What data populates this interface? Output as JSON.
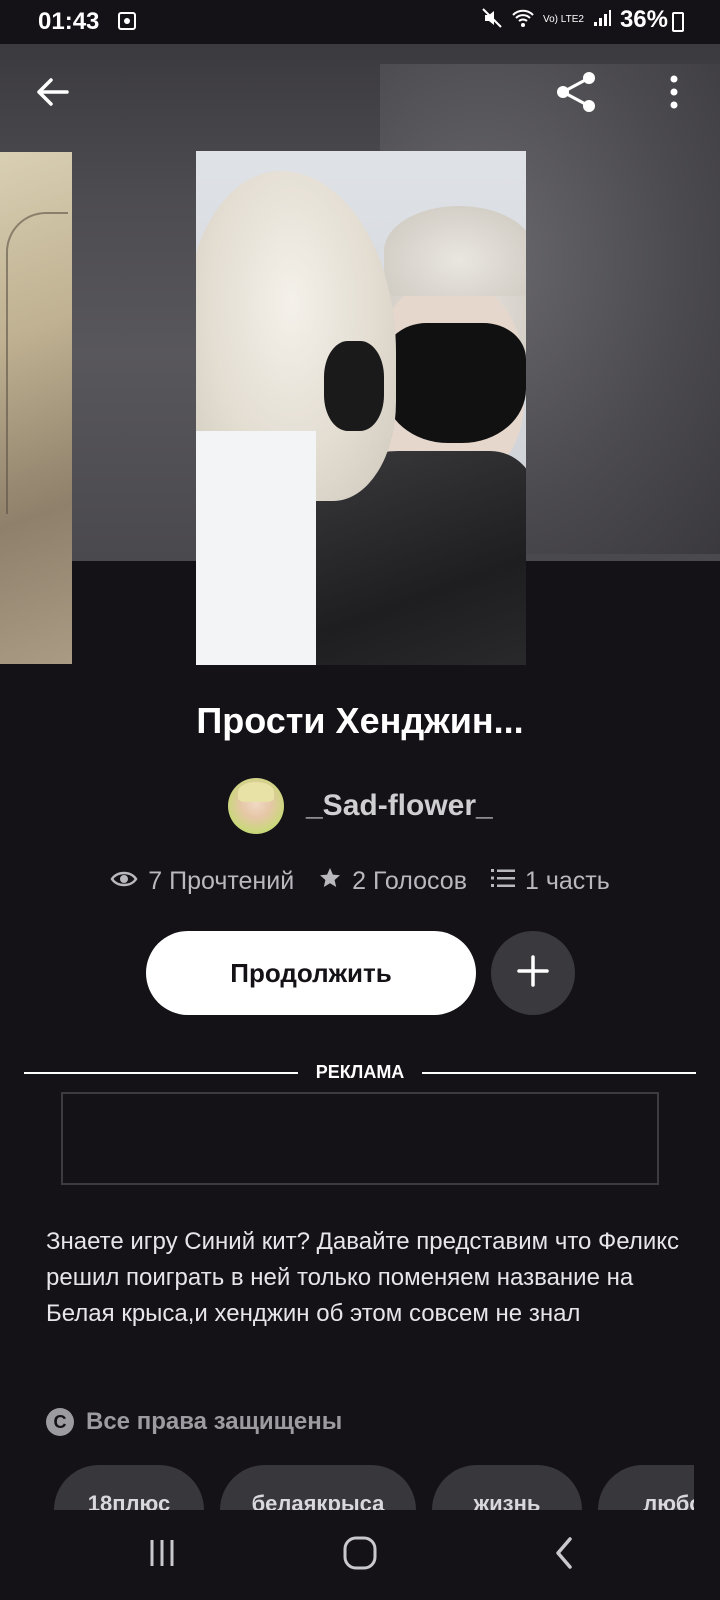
{
  "status_bar": {
    "time": "01:43",
    "network": "Vo) LTE2",
    "battery": "36%"
  },
  "toolbar": {
    "back_icon": "arrow-left-icon",
    "share_icon": "share-icon",
    "more_icon": "more-vertical-icon"
  },
  "story": {
    "title": "Прости Хенджин...",
    "author": "_Sad-flower_",
    "reads": "7 Прочтений",
    "votes": "2 Голосов",
    "parts": "1 часть",
    "continue_label": "Продолжить",
    "add_label": "+",
    "description": "Знаете игру Синий кит? Давайте представим что Феликс решил поиграть в ней только поменяем название на Белая крыса,и хенджин об этом совсем не знал",
    "rights": "Все права защищены",
    "tags": [
      "18плюс",
      "белаякрыса",
      "жизнь",
      "любо"
    ]
  },
  "ad": {
    "label": "РЕКЛАМА"
  }
}
